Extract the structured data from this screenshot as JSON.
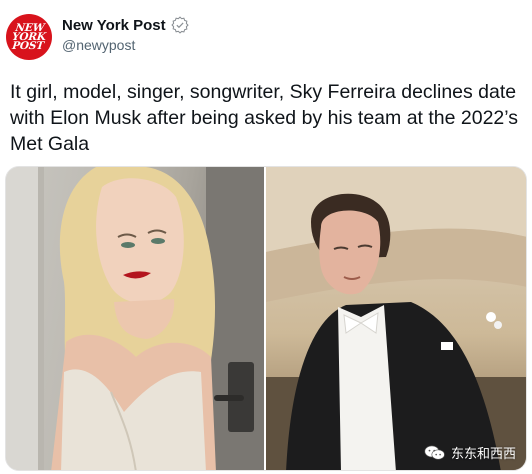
{
  "account": {
    "display_name": "New York Post",
    "handle": "@newypost",
    "logo_lines": [
      "NEW",
      "YORK",
      "POST"
    ],
    "brand_color": "#d8131c"
  },
  "tweet": {
    "text": "It girl, model, singer, songwriter, Sky Ferreira declines date with Elon Musk after being asked by his team at the 2022’s Met Gala"
  },
  "media": {
    "watermark_text": "东东和西西"
  },
  "icons": {
    "verified": "verified-badge-icon",
    "watermark": "wechat-icon"
  }
}
